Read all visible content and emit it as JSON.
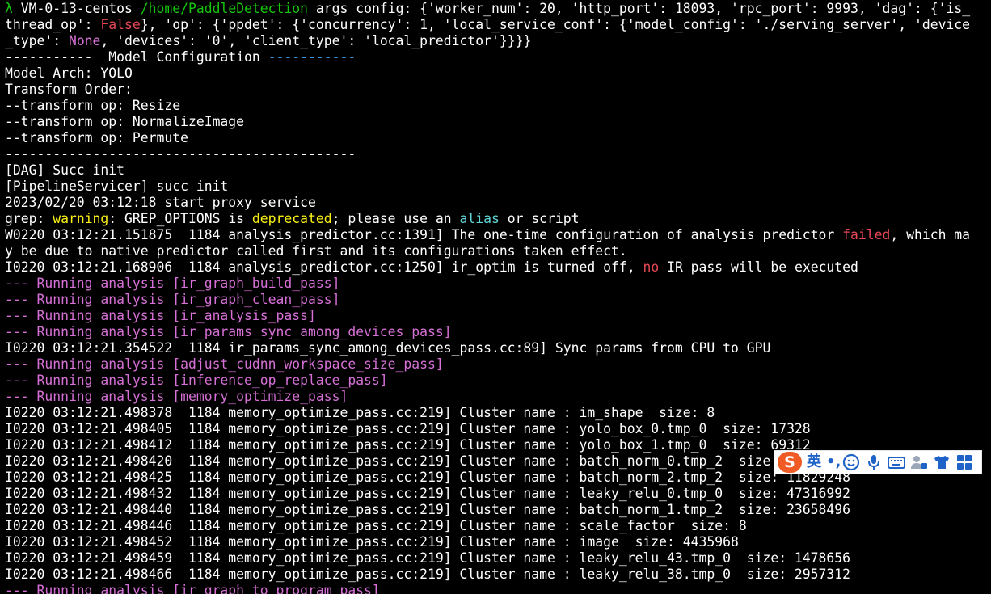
{
  "terminal": {
    "lines": [
      [
        {
          "t": "λ ",
          "c": "c-green"
        },
        {
          "t": "VM-0-13-centos ",
          "c": "c-white"
        },
        {
          "t": "/home/PaddleDetection",
          "c": "c-green"
        },
        {
          "t": " args config: {'worker_num': 20, 'http_port': 18093, 'rpc_port': 9993, 'dag': {'is_",
          "c": "c-white"
        }
      ],
      [
        {
          "t": "thread_op': ",
          "c": "c-white"
        },
        {
          "t": "False",
          "c": "c-red"
        },
        {
          "t": "}, 'op': {'ppdet': {'concurrency': 1, 'local_service_conf': {'model_config': './serving_server', 'device",
          "c": "c-white"
        }
      ],
      [
        {
          "t": "_type': ",
          "c": "c-white"
        },
        {
          "t": "None",
          "c": "c-pink"
        },
        {
          "t": ", 'devices': '0', 'client_type': 'local_predictor'}}}}",
          "c": "c-white"
        }
      ],
      [
        {
          "t": "-----------  Model Configuration ",
          "c": "c-white"
        },
        {
          "t": "-----------",
          "c": "c-blue"
        }
      ],
      [
        {
          "t": "Model Arch: YOLO",
          "c": "c-white"
        }
      ],
      [
        {
          "t": "Transform Order:",
          "c": "c-white"
        }
      ],
      [
        {
          "t": "--transform op: Resize",
          "c": "c-white"
        }
      ],
      [
        {
          "t": "--transform op: NormalizeImage",
          "c": "c-white"
        }
      ],
      [
        {
          "t": "--transform op: Permute",
          "c": "c-white"
        }
      ],
      [
        {
          "t": "--------------------------------------------",
          "c": "c-white"
        }
      ],
      [
        {
          "t": "[DAG] Succ init",
          "c": "c-white"
        }
      ],
      [
        {
          "t": "[PipelineServicer] succ init",
          "c": "c-white"
        }
      ],
      [
        {
          "t": "2023/02/20 03:12:18 start proxy service",
          "c": "c-white"
        }
      ],
      [
        {
          "t": "grep: ",
          "c": "c-white"
        },
        {
          "t": "warning",
          "c": "c-yellow"
        },
        {
          "t": ": GREP_OPTIONS is ",
          "c": "c-white"
        },
        {
          "t": "deprecated",
          "c": "c-yellow"
        },
        {
          "t": "; please use an ",
          "c": "c-white"
        },
        {
          "t": "alias",
          "c": "c-cyan"
        },
        {
          "t": " or script",
          "c": "c-white"
        }
      ],
      [
        {
          "t": "W0220 03:12:21.151875  1184 analysis_predictor.cc:1391] The one-time configuration of analysis predictor ",
          "c": "c-white"
        },
        {
          "t": "failed",
          "c": "c-red"
        },
        {
          "t": ", which ma",
          "c": "c-white"
        }
      ],
      [
        {
          "t": "y be due to native predictor called first and its configurations taken effect.",
          "c": "c-white"
        }
      ],
      [
        {
          "t": "I0220 03:12:21.168906  1184 analysis_predictor.cc:1250] ir_optim is turned off, ",
          "c": "c-white"
        },
        {
          "t": "no",
          "c": "c-red"
        },
        {
          "t": " IR pass will be executed",
          "c": "c-white"
        }
      ],
      [
        {
          "t": "--- Running analysis [ir_graph_build_pass]",
          "c": "c-pink"
        }
      ],
      [
        {
          "t": "--- Running analysis [ir_graph_clean_pass]",
          "c": "c-pink"
        }
      ],
      [
        {
          "t": "--- Running analysis [ir_analysis_pass]",
          "c": "c-pink"
        }
      ],
      [
        {
          "t": "--- Running analysis [ir_params_sync_among_devices_pass]",
          "c": "c-pink"
        }
      ],
      [
        {
          "t": "I0220 03:12:21.354522  1184 ir_params_sync_among_devices_pass.cc:89] Sync params from CPU to GPU",
          "c": "c-white"
        }
      ],
      [
        {
          "t": "--- Running analysis [adjust_cudnn_workspace_size_pass]",
          "c": "c-pink"
        }
      ],
      [
        {
          "t": "--- Running analysis [inference_op_replace_pass]",
          "c": "c-pink"
        }
      ],
      [
        {
          "t": "--- Running analysis [memory_optimize_pass]",
          "c": "c-pink"
        }
      ],
      [
        {
          "t": "I0220 03:12:21.498378  1184 memory_optimize_pass.cc:219] Cluster name : im_shape  size: 8",
          "c": "c-white"
        }
      ],
      [
        {
          "t": "I0220 03:12:21.498405  1184 memory_optimize_pass.cc:219] Cluster name : yolo_box_0.tmp_0  size: 17328",
          "c": "c-white"
        }
      ],
      [
        {
          "t": "I0220 03:12:21.498412  1184 memory_optimize_pass.cc:219] Cluster name : yolo_box_1.tmp_0  size: 69312",
          "c": "c-white"
        }
      ],
      [
        {
          "t": "I0220 03:12:21.498420  1184 memory_optimize_pass.cc:219] Cluster name : batch_norm_0.tmp_2  size",
          "c": "c-white"
        }
      ],
      [
        {
          "t": "I0220 03:12:21.498425  1184 memory_optimize_pass.cc:219] Cluster name : batch_norm_2.tmp_2  size: 11829248",
          "c": "c-white"
        }
      ],
      [
        {
          "t": "I0220 03:12:21.498432  1184 memory_optimize_pass.cc:219] Cluster name : leaky_relu_0.tmp_0  size: 47316992",
          "c": "c-white"
        }
      ],
      [
        {
          "t": "I0220 03:12:21.498440  1184 memory_optimize_pass.cc:219] Cluster name : batch_norm_1.tmp_2  size: 23658496",
          "c": "c-white"
        }
      ],
      [
        {
          "t": "I0220 03:12:21.498446  1184 memory_optimize_pass.cc:219] Cluster name : scale_factor  size: 8",
          "c": "c-white"
        }
      ],
      [
        {
          "t": "I0220 03:12:21.498452  1184 memory_optimize_pass.cc:219] Cluster name : image  size: 4435968",
          "c": "c-white"
        }
      ],
      [
        {
          "t": "I0220 03:12:21.498459  1184 memory_optimize_pass.cc:219] Cluster name : leaky_relu_43.tmp_0  size: 1478656",
          "c": "c-white"
        }
      ],
      [
        {
          "t": "I0220 03:12:21.498466  1184 memory_optimize_pass.cc:219] Cluster name : leaky_relu_38.tmp_0  size: 2957312",
          "c": "c-white"
        }
      ],
      [
        {
          "t": "--- Running analysis [ir_graph_to_program_pass]",
          "c": "c-pink"
        }
      ]
    ]
  },
  "ime": {
    "logo": "S",
    "mode": "英",
    "punct": "•,",
    "icons": [
      "smiley-icon",
      "microphone-icon",
      "keyboard-icon",
      "user-tools-icon",
      "skin-shirt-icon",
      "grid-menu-icon"
    ],
    "accent": "#1f63c8",
    "brand": "#f05a24"
  }
}
